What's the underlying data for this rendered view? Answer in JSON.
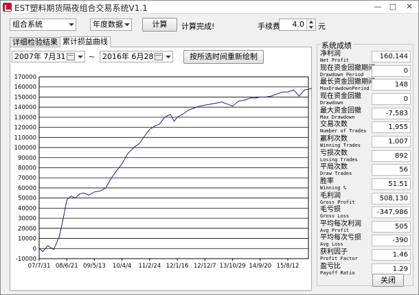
{
  "window": {
    "title": "EST塑料期货隔夜组合交易系统V1.1",
    "min": "—",
    "max": "□",
    "close": "✕"
  },
  "toolbar": {
    "system_select": "组合系统",
    "period_select": "年度数据",
    "calc_button": "计算",
    "status": "计算完成!",
    "fee_label": "手续费",
    "fee_value": "4.0",
    "fee_unit": "元"
  },
  "tabs": [
    {
      "label": "详细检验结果",
      "active": false
    },
    {
      "label": "累计损益曲线",
      "active": true
    }
  ],
  "date_range": {
    "start": "2007年 7月31日",
    "separator": "~",
    "end": "2016年 6月28日",
    "redraw_button": "按所选时间重新绘制"
  },
  "chart_data": {
    "type": "line",
    "x_ticks": [
      "07/7/31",
      "08/6/21",
      "09/5/13",
      "10/4/4",
      "11/2/24",
      "12/1/16",
      "12/12/7",
      "13/10/29",
      "14/9/20",
      "15/8/12"
    ],
    "y_ticks": [
      "170000",
      "160000",
      "150000",
      "140000",
      "130000",
      "120000",
      "110000",
      "100000",
      "90000",
      "80000",
      "70000",
      "60000",
      "50000",
      "40000",
      "30000",
      "20000",
      "10000",
      "0",
      "-10000"
    ],
    "ylim": [
      -10000,
      170000
    ],
    "series": [
      {
        "color": "#1a1a8c",
        "x": [
          "07/7/31",
          "07/9/15",
          "07/11/10",
          "08/1/20",
          "08/3/25",
          "08/5/10",
          "08/6/21",
          "08/8/10",
          "08/9/30",
          "08/11/20",
          "09/1/10",
          "09/3/5",
          "09/5/13",
          "09/7/20",
          "09/9/25",
          "09/12/1",
          "10/2/10",
          "10/4/4",
          "10/6/10",
          "10/8/20",
          "10/10/25",
          "10/12/30",
          "11/2/24",
          "11/4/20",
          "11/6/15",
          "11/8/20",
          "11/10/25",
          "11/12/10",
          "12/1/16",
          "12/3/20",
          "12/5/25",
          "12/7/30",
          "12/10/5",
          "12/12/7",
          "13/2/15",
          "13/4/20",
          "13/6/25",
          "13/8/30",
          "13/10/29",
          "14/1/10",
          "14/3/20",
          "14/5/25",
          "14/7/30",
          "14/9/20",
          "14/11/25",
          "15/1/30",
          "15/4/5",
          "15/6/10",
          "15/8/12",
          "15/10/20",
          "15/12/25",
          "16/2/28",
          "16/4/30",
          "16/6/28"
        ],
        "values": [
          0,
          -3000,
          3000,
          -1000,
          12000,
          30000,
          48000,
          52000,
          50000,
          54000,
          55000,
          53000,
          56000,
          57000,
          60000,
          70000,
          78000,
          84000,
          94000,
          100000,
          104000,
          112000,
          118000,
          121000,
          123000,
          130000,
          133000,
          126000,
          130000,
          133000,
          137000,
          139000,
          141000,
          142000,
          143000,
          144000,
          145000,
          143000,
          141000,
          146000,
          147000,
          149000,
          149000,
          150000,
          150000,
          151000,
          153000,
          155000,
          155000,
          157000,
          151000,
          157000,
          158000,
          160144
        ]
      }
    ]
  },
  "results": {
    "title": "系统成绩",
    "close_button": "关闭",
    "stats": [
      {
        "zh": "净利润",
        "en": "Net Profit",
        "value": "160,144"
      },
      {
        "zh": "现在资金回撤期间",
        "en": "Drawdown Period",
        "value": "0"
      },
      {
        "zh": "最长资金回撤期间",
        "en": "MaxDrawdownPeriod",
        "value": "148"
      },
      {
        "zh": "现在资金回撤",
        "en": "Drawdown",
        "value": "0"
      },
      {
        "zh": "最大资金回撤",
        "en": "Max Drawdown",
        "value": "-7,583"
      },
      {
        "zh": "交易次数",
        "en": "Number of Trades",
        "value": "1,955"
      },
      {
        "zh": "赢利次数",
        "en": "Winning Trades",
        "value": "1,007"
      },
      {
        "zh": "亏损次数",
        "en": "Losing Trades",
        "value": "892"
      },
      {
        "zh": "平局次数",
        "en": "Draw Trades",
        "value": "56"
      },
      {
        "zh": "胜率",
        "en": "Winning %",
        "value": "51.51"
      },
      {
        "zh": "毛利润",
        "en": "Gross Profit",
        "value": "508,130"
      },
      {
        "zh": "毛亏损",
        "en": "Gross Loss",
        "value": "-347,986"
      },
      {
        "zh": "平均每次利润",
        "en": "Avg Profit",
        "value": "505"
      },
      {
        "zh": "平均每次亏损",
        "en": "Avg Loss",
        "value": "-390"
      },
      {
        "zh": "获利因子",
        "en": "Profit Factor",
        "value": "1.46"
      },
      {
        "zh": "盈亏比",
        "en": "Payoff Ratio",
        "value": "1.29"
      }
    ]
  }
}
